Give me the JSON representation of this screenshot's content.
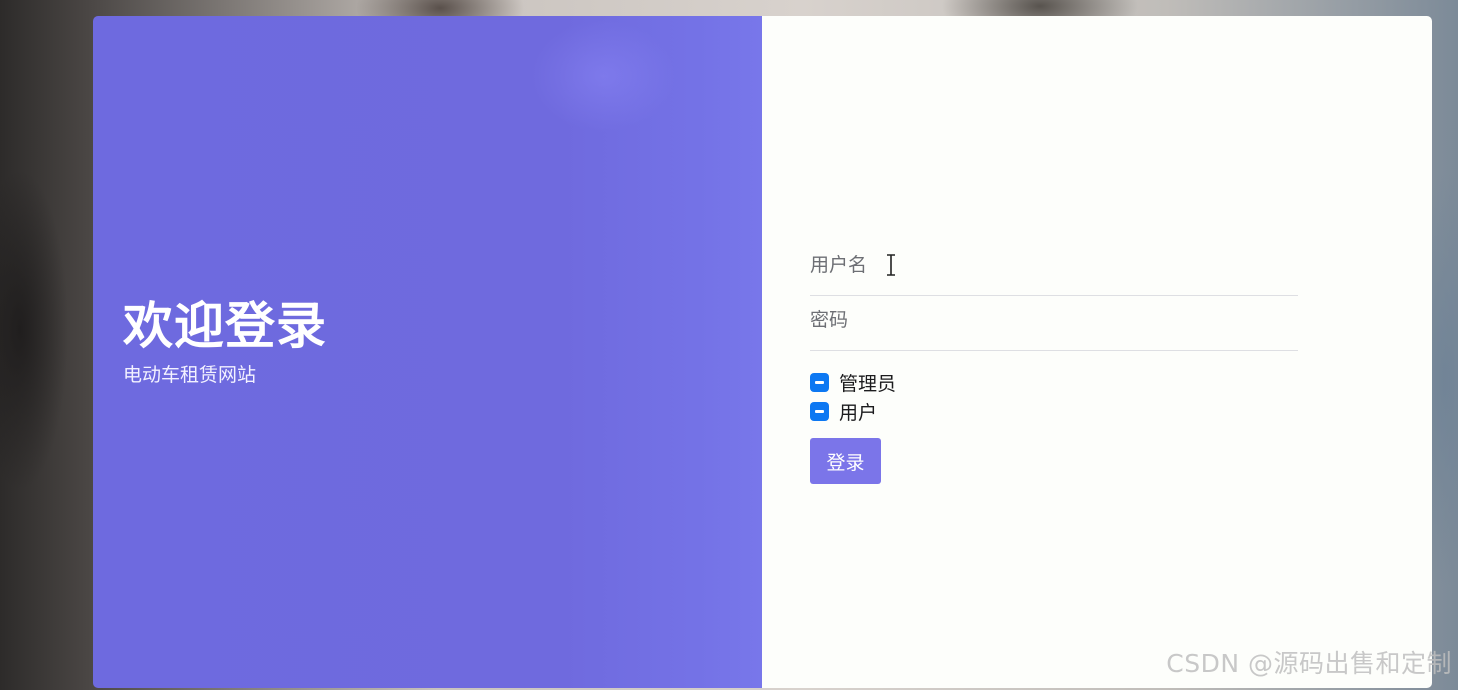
{
  "left_panel": {
    "title": "欢迎登录",
    "subtitle": "电动车租赁网站"
  },
  "form": {
    "username": {
      "placeholder": "用户名",
      "value": ""
    },
    "password": {
      "placeholder": "密码",
      "value": ""
    },
    "roles": [
      {
        "label": "管理员",
        "state": "indeterminate"
      },
      {
        "label": "用户",
        "state": "indeterminate"
      }
    ],
    "submit_label": "登录"
  },
  "watermark": "CSDN @源码出售和定制",
  "colors": {
    "left_panel_bg": "#6e6adf",
    "right_panel_bg": "#fdfefb",
    "checkbox": "#0d78f2",
    "button": "#7b75e9"
  },
  "icons": {
    "cursor": "text-cursor-icon",
    "checkbox": "checkbox-indeterminate-icon"
  }
}
